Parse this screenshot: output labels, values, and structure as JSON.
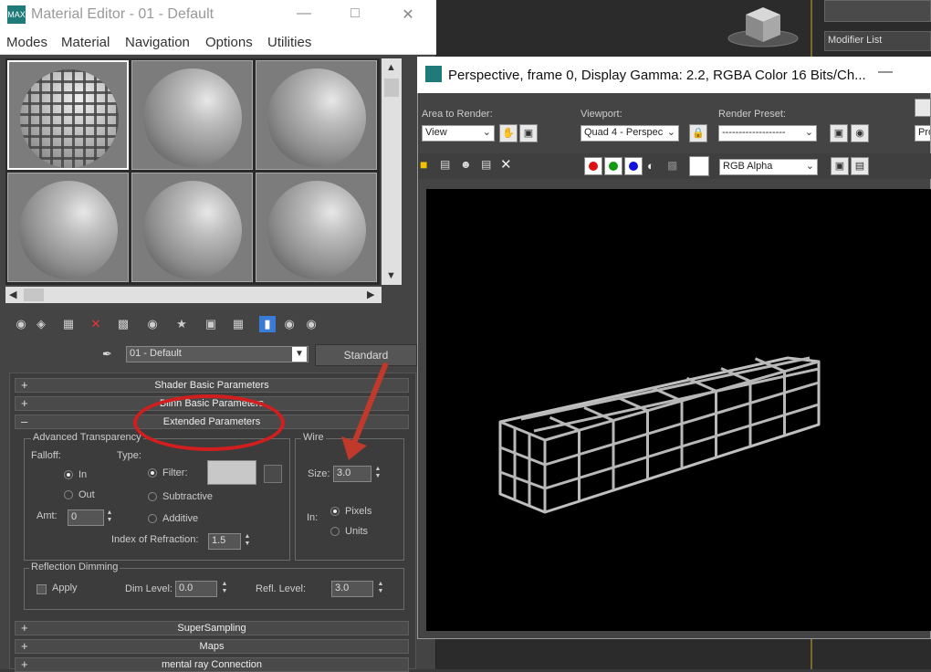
{
  "material_editor": {
    "title": "Material Editor - 01 - Default",
    "menu": [
      "Modes",
      "Material",
      "Navigation",
      "Options",
      "Utilities"
    ],
    "material_name": "01 - Default",
    "material_type": "Standard",
    "rollouts": {
      "shader_basic": "Shader Basic Parameters",
      "blinn_basic": "Blinn Basic Parameters",
      "extended": "Extended Parameters",
      "supersampling": "SuperSampling",
      "maps": "Maps",
      "mental_ray": "mental ray Connection"
    },
    "adv_transparency": {
      "title": "Advanced Transparency",
      "falloff": "Falloff:",
      "type": "Type:",
      "in": "In",
      "out": "Out",
      "filter": "Filter:",
      "subtractive": "Subtractive",
      "additive": "Additive",
      "amt_label": "Amt:",
      "amt_value": "0",
      "ior_label": "Index of Refraction:",
      "ior_value": "1.5"
    },
    "wire": {
      "title": "Wire",
      "size_label": "Size:",
      "size_value": "3.0",
      "in_label": "In:",
      "pixels": "Pixels",
      "units": "Units"
    },
    "reflection_dimming": {
      "title": "Reflection Dimming",
      "apply": "Apply",
      "dim_label": "Dim Level:",
      "dim_value": "0.0",
      "refl_label": "Refl. Level:",
      "refl_value": "3.0"
    }
  },
  "render_window": {
    "title": "Perspective, frame 0, Display Gamma: 2.2, RGBA Color 16 Bits/Ch...",
    "area_label": "Area to Render:",
    "area_value": "View",
    "viewport_label": "Viewport:",
    "viewport_value": "Quad 4 - Perspec",
    "preset_label": "Render Preset:",
    "preset_value": "-------------------",
    "production": "Pro",
    "channel_value": "RGB Alpha"
  },
  "max_app": {
    "modifier_list": "Modifier List"
  },
  "colors": {
    "annotation_red": "#d21e1e",
    "swatch_red": "#dd1111",
    "swatch_green": "#119911",
    "swatch_blue": "#1111dd"
  }
}
